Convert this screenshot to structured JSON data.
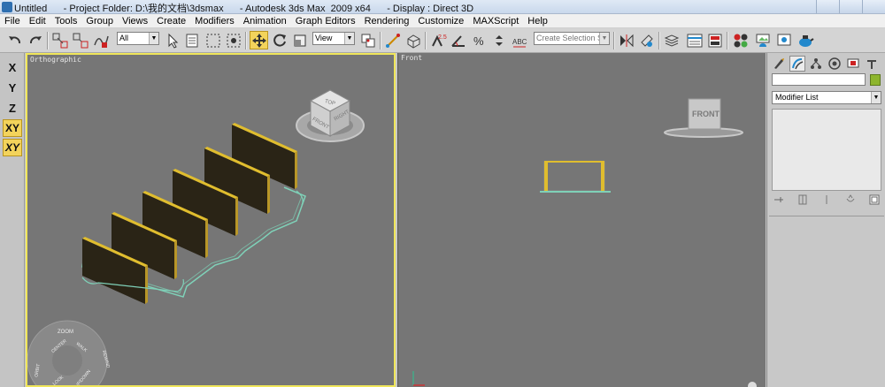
{
  "titlebar": {
    "text": "Untitled      - Project Folder: D:\\我的文档\\3dsmax      - Autodesk 3ds Max  2009 x64      - Display : Direct 3D"
  },
  "menu": [
    "File",
    "Edit",
    "Tools",
    "Group",
    "Views",
    "Create",
    "Modifiers",
    "Animation",
    "Graph Editors",
    "Rendering",
    "Customize",
    "MAXScript",
    "Help"
  ],
  "toolbar": {
    "selection_filter": "All",
    "ref_coord": "View",
    "named_selection_placeholder": "Create Selection Set",
    "active_tool": "select-and-move",
    "snap_labels": [
      "2.5",
      "%"
    ]
  },
  "axis_constraints": [
    "X",
    "Y",
    "Z",
    "XY",
    "XY"
  ],
  "axis_active": [
    3,
    4
  ],
  "viewports": {
    "left": {
      "label": "Orthographic",
      "active": true,
      "viewcube_faces": [
        "TOP",
        "FRONT",
        "RIGHT"
      ],
      "steering_wheel": [
        "ZOOM",
        "CENTER",
        "WALK",
        "REWIND",
        "ORBIT",
        "LOOK",
        "UP/DOWN"
      ]
    },
    "right": {
      "label": "Front",
      "viewcube_faces": [
        "FRONT"
      ]
    }
  },
  "command_panel": {
    "modifier_list": "Modifier List",
    "object_color": "#8db52c"
  },
  "colors": {
    "viewport_bg": "#767676",
    "active_border": "#f0e65a",
    "panel_dark": "#2a2416",
    "panel_edge": "#e0bd2e",
    "spline": "#7fd1b8"
  }
}
